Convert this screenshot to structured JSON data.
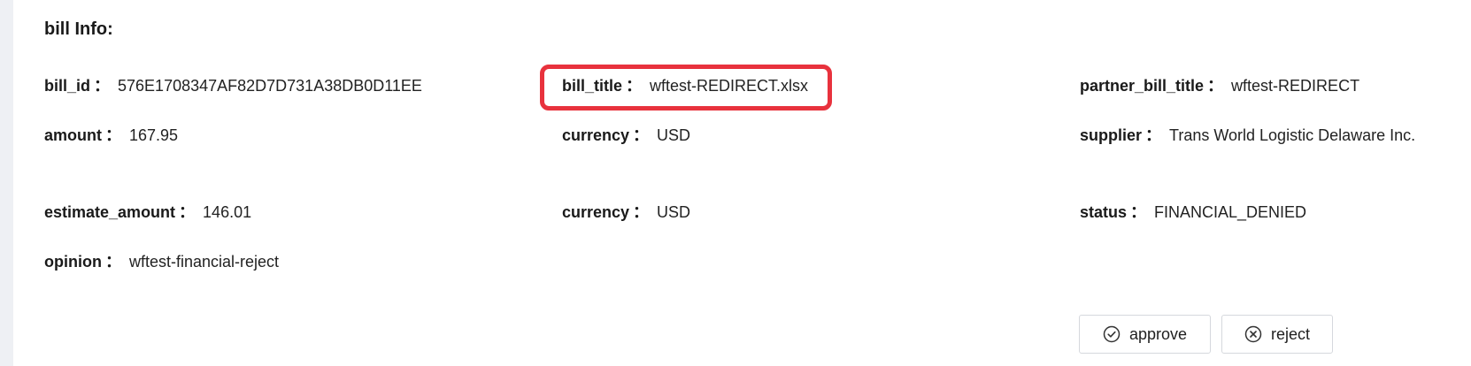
{
  "section": {
    "title": "bill Info:"
  },
  "separator": "：",
  "fields": {
    "bill_id": {
      "label": "bill_id",
      "value": "576E1708347AF82D7D731A38DB0D11EE"
    },
    "bill_title": {
      "label": "bill_title",
      "value": "wftest-REDIRECT.xlsx"
    },
    "partner_bill_title": {
      "label": "partner_bill_title",
      "value": "wftest-REDIRECT"
    },
    "amount": {
      "label": "amount",
      "value": "167.95"
    },
    "currency": {
      "label": "currency",
      "value": "USD"
    },
    "supplier": {
      "label": "supplier",
      "value": "Trans World Logistic Delaware Inc."
    },
    "estimate_amount": {
      "label": "estimate_amount",
      "value": "146.01"
    },
    "estimate_currency": {
      "label": "currency",
      "value": "USD"
    },
    "status": {
      "label": "status",
      "value": "FINANCIAL_DENIED"
    },
    "opinion": {
      "label": "opinion",
      "value": "wftest-financial-reject"
    }
  },
  "actions": {
    "approve": {
      "label": "approve",
      "icon": "check-circle-icon"
    },
    "reject": {
      "label": "reject",
      "icon": "x-circle-icon"
    }
  },
  "colors": {
    "highlight": "#e8323d",
    "background": "#eef0f4"
  }
}
